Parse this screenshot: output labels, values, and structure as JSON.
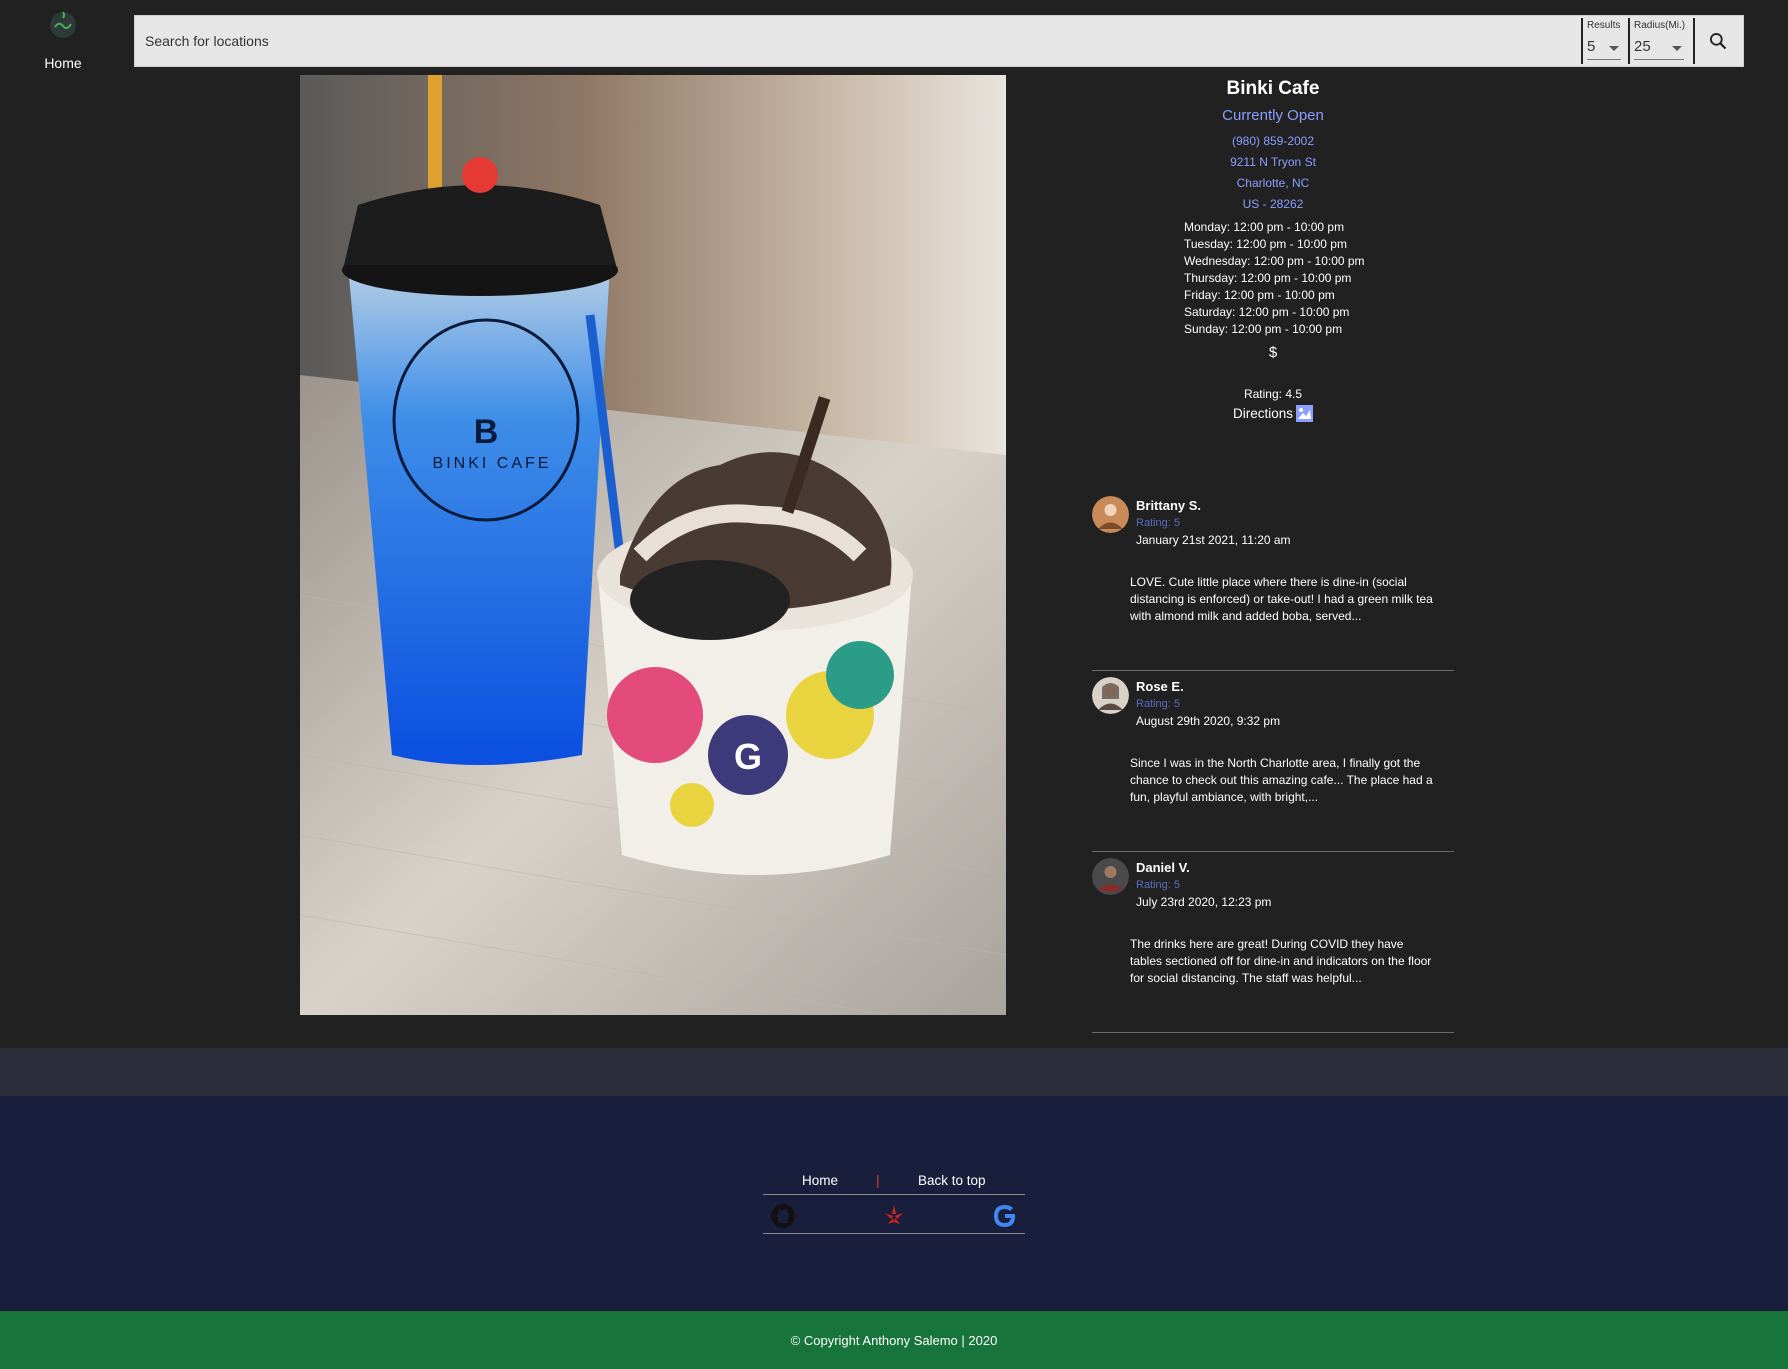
{
  "nav": {
    "home_label": "Home"
  },
  "search": {
    "placeholder": "Search for locations",
    "results_label": "Results",
    "results_value": "5",
    "radius_label": "Radius(Mi.)",
    "radius_value": "25"
  },
  "business": {
    "name": "Binki Cafe",
    "status": "Currently Open",
    "phone": "(980) 859-2002",
    "address1": "9211 N Tryon St",
    "address2": "Charlotte, NC",
    "address3": "US - 28262",
    "hours": [
      "Monday: 12:00 pm - 10:00 pm",
      "Tuesday: 12:00 pm - 10:00 pm",
      "Wednesday: 12:00 pm - 10:00 pm",
      "Thursday: 12:00 pm - 10:00 pm",
      "Friday: 12:00 pm - 10:00 pm",
      "Saturday: 12:00 pm - 10:00 pm",
      "Sunday: 12:00 pm - 10:00 pm"
    ],
    "price": "$",
    "rating": "Rating: 4.5",
    "directions": "Directions"
  },
  "reviews": [
    {
      "name": "Brittany S.",
      "rating": "Rating: 5",
      "date": "January 21st 2021, 11:20 am",
      "text": "LOVE. Cute little place where there is dine-in (social distancing is enforced) or take-out! I had a green milk tea with almond milk and added boba, served..."
    },
    {
      "name": "Rose E.",
      "rating": "Rating: 5",
      "date": "August 29th 2020, 9:32 pm",
      "text": "Since I was in the North Charlotte area, I finally got the chance to check out this amazing cafe... The place had a fun, playful ambiance, with bright,..."
    },
    {
      "name": "Daniel V.",
      "rating": "Rating: 5",
      "date": "July 23rd 2020, 12:23 pm",
      "text": "The drinks here are great! During COVID they have tables sectioned off for dine-in and indicators on the floor for social distancing. The staff was helpful..."
    }
  ],
  "footer": {
    "home_link": "Home",
    "separator": "|",
    "top_link": "Back to top",
    "copyright": "© Copyright Anthony Salemo | 2020"
  },
  "photo": {
    "cup_text": "BINKI CAFE",
    "cup_logo_letter": "B",
    "bowl_letter": "G"
  }
}
